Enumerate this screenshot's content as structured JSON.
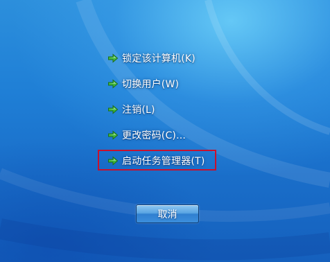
{
  "menu": {
    "items": [
      {
        "label": "锁定该计算机(K)",
        "icon": "green-arrow-icon"
      },
      {
        "label": "切换用户(W)",
        "icon": "green-arrow-icon"
      },
      {
        "label": "注销(L)",
        "icon": "green-arrow-icon"
      },
      {
        "label": "更改密码(C)...",
        "icon": "green-arrow-icon"
      },
      {
        "label": "启动任务管理器(T)",
        "icon": "green-arrow-icon"
      }
    ]
  },
  "cancel_button": {
    "label": "取消"
  },
  "colors": {
    "background": "#1f7fd6",
    "arrow": "#3fb83a",
    "highlight_border": "#c8102e",
    "text": "#ffffff"
  }
}
